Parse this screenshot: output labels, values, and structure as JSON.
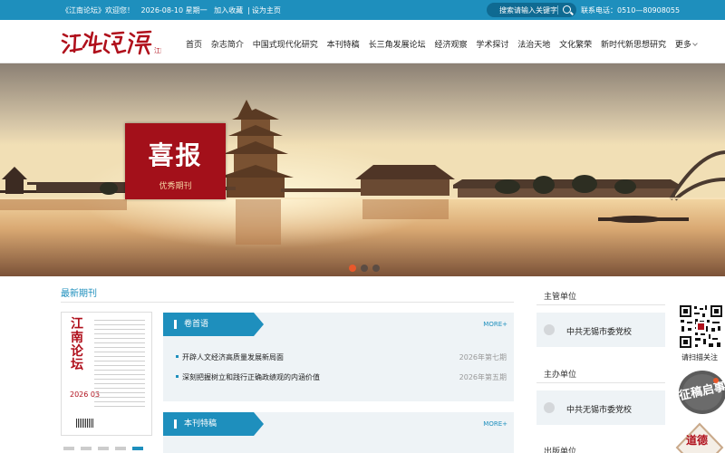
{
  "topbar": {
    "welcome": "《江南论坛》欢迎您！",
    "date": "2026-08-10 星期一",
    "bookmark": "加入收藏",
    "separator": "|",
    "homepage": "设为主页",
    "search_placeholder": "搜索请输入关键字",
    "phone": "联系电话：0510—80908055",
    "colors": {
      "bar": "#1e8fbd",
      "search": "#0f6a92"
    }
  },
  "header": {
    "logo_text": "江南论坛",
    "nav": [
      "首页",
      "杂志简介",
      "中国式现代化研究",
      "本刊特稿",
      "长三角发展论坛",
      "经济观察",
      "学术探讨",
      "法治天地",
      "文化繁荣",
      "新时代新思想研究",
      "更多"
    ]
  },
  "banner": {
    "badge_big": "喜报",
    "badge_small": "优秀期刊",
    "slide_count": 3,
    "active_slide": 1,
    "colors": {
      "badge": "#a3101a",
      "active_dot": "#e8582b"
    }
  },
  "latest": {
    "title": "最新期刊",
    "cover_title": "江南论坛",
    "cover_issue": "2026 03"
  },
  "panels": [
    {
      "tab": "卷首语",
      "more": "MORE+",
      "items": [
        {
          "title": "开辟人文经济高质量发展新局面",
          "date": "2026年第七期"
        },
        {
          "title": "深刻把握树立和践行正确政绩观的内涵价值",
          "date": "2026年第五期"
        }
      ]
    },
    {
      "tab": "本刊特稿",
      "more": "MORE+",
      "items": []
    }
  ],
  "sidebar": {
    "sections": [
      {
        "title": "主管单位",
        "name": "中共无锡市委党校"
      },
      {
        "title": "主办单位",
        "name": "中共无锡市委党校"
      },
      {
        "title": "出版单位",
        "name": ""
      }
    ],
    "qr_label": "请扫描关注",
    "float_banner_1": "征稿启事",
    "float_banner_2": "道德"
  }
}
